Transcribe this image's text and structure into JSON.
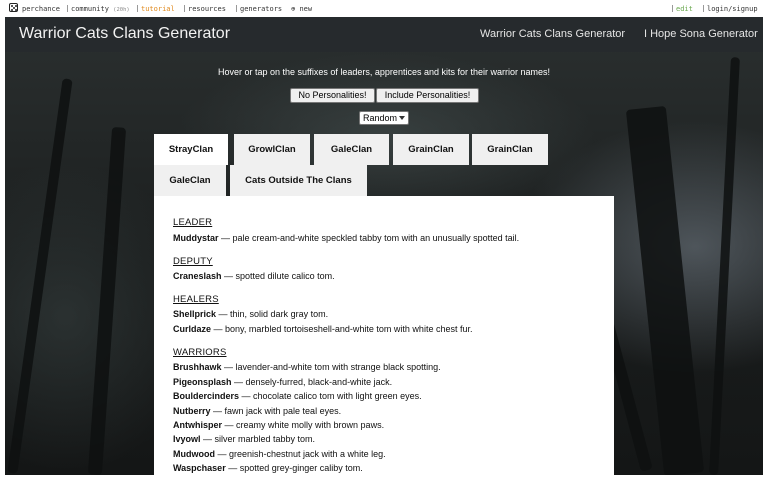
{
  "sitebar": {
    "items": [
      {
        "label": "perchance"
      },
      {
        "label": "community",
        "sub": "(20h)"
      },
      {
        "label": "tutorial"
      },
      {
        "label": "resources"
      },
      {
        "label": "generators"
      },
      {
        "label": "new",
        "icon": "plus-circle-icon"
      },
      {
        "label": "edit"
      },
      {
        "label": "login/signup"
      }
    ]
  },
  "header": {
    "title": "Warrior Cats Clans Generator",
    "nav": [
      "Warrior Cats Clans Generator",
      "I Hope Sona Generator"
    ]
  },
  "instruction": "Hover or tap on the suffixes of leaders, apprentices and kits for their warrior names!",
  "buttons": {
    "no_personalities": "No Personalities!",
    "include_personalities": "Include Personalities!"
  },
  "select": {
    "value": "Random"
  },
  "tabs": [
    "StrayClan",
    "GrowlClan",
    "GaleClan",
    "GrainClan",
    "GrainClan",
    "GaleClan",
    "Cats Outside The Clans"
  ],
  "content": {
    "leader": {
      "heading": "LEADER",
      "entries": [
        {
          "name": "Muddystar",
          "desc": " — pale cream-and-white speckled tabby tom with an unusually spotted tail."
        }
      ]
    },
    "deputy": {
      "heading": "DEPUTY",
      "entries": [
        {
          "name": "Craneslash",
          "desc": " — spotted dilute calico tom."
        }
      ]
    },
    "healers": {
      "heading": "HEALERS",
      "entries": [
        {
          "name": "Shellprick",
          "desc": " — thin, solid dark gray tom."
        },
        {
          "name": "Curldaze",
          "desc": " — bony, marbled tortoiseshell-and-white tom with white chest fur."
        }
      ]
    },
    "warriors": {
      "heading": "WARRIORS",
      "entries": [
        {
          "name": "Brushhawk",
          "desc": " — lavender-and-white tom with strange black spotting."
        },
        {
          "name": "Pigeonsplash",
          "desc": " — densely-furred, black-and-white jack."
        },
        {
          "name": "Bouldercinders",
          "desc": " — chocolate calico tom with light green eyes."
        },
        {
          "name": "Nutberry",
          "desc": " — fawn jack with pale teal eyes."
        },
        {
          "name": "Antwhisper",
          "desc": " — creamy white molly with brown paws."
        },
        {
          "name": "Ivyowl",
          "desc": " — silver marbled tabby tom."
        },
        {
          "name": "Mudwood",
          "desc": " — greenish-chestnut jack with a white leg."
        },
        {
          "name": "Waspchaser",
          "desc": " — spotted grey-ginger caliby tom."
        }
      ]
    }
  }
}
